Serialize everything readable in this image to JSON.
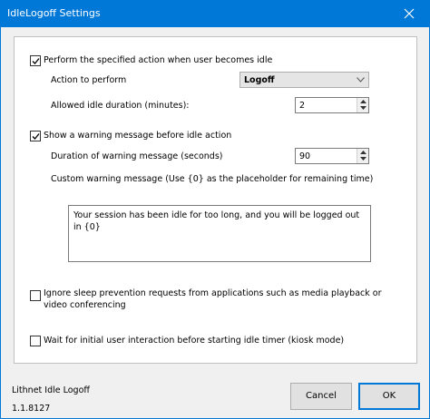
{
  "window": {
    "title": "IdleLogoff Settings"
  },
  "settings": {
    "perform_action_label": "Perform the specified action when user becomes idle",
    "perform_action_checked": true,
    "action_label": "Action to perform",
    "action_value": "Logoff",
    "idle_duration_label": "Allowed idle duration (minutes):",
    "idle_duration_value": "2",
    "warning_label": "Show a warning message before idle action",
    "warning_checked": true,
    "warning_duration_label": "Duration of warning message (seconds)",
    "warning_duration_value": "90",
    "custom_message_label": "Custom warning message (Use {0} as the placeholder for remaining time)",
    "custom_message_value": "Your session has been idle for too long, and you will be logged out in {0}",
    "ignore_sleep_label_line1": "Ignore sleep prevention requests from applications such as media playback or",
    "ignore_sleep_label_line2": "video conferencing",
    "ignore_sleep_checked": false,
    "kiosk_label": "Wait for initial user interaction before starting idle timer (kiosk mode)",
    "kiosk_checked": false
  },
  "footer": {
    "product_name": "Lithnet Idle Logoff",
    "version": "1.1.8127",
    "cancel_label": "Cancel",
    "ok_label": "OK"
  },
  "colors": {
    "accent": "#0078d7",
    "window_bg": "#f0f0f0",
    "panel_bg": "#ffffff"
  }
}
